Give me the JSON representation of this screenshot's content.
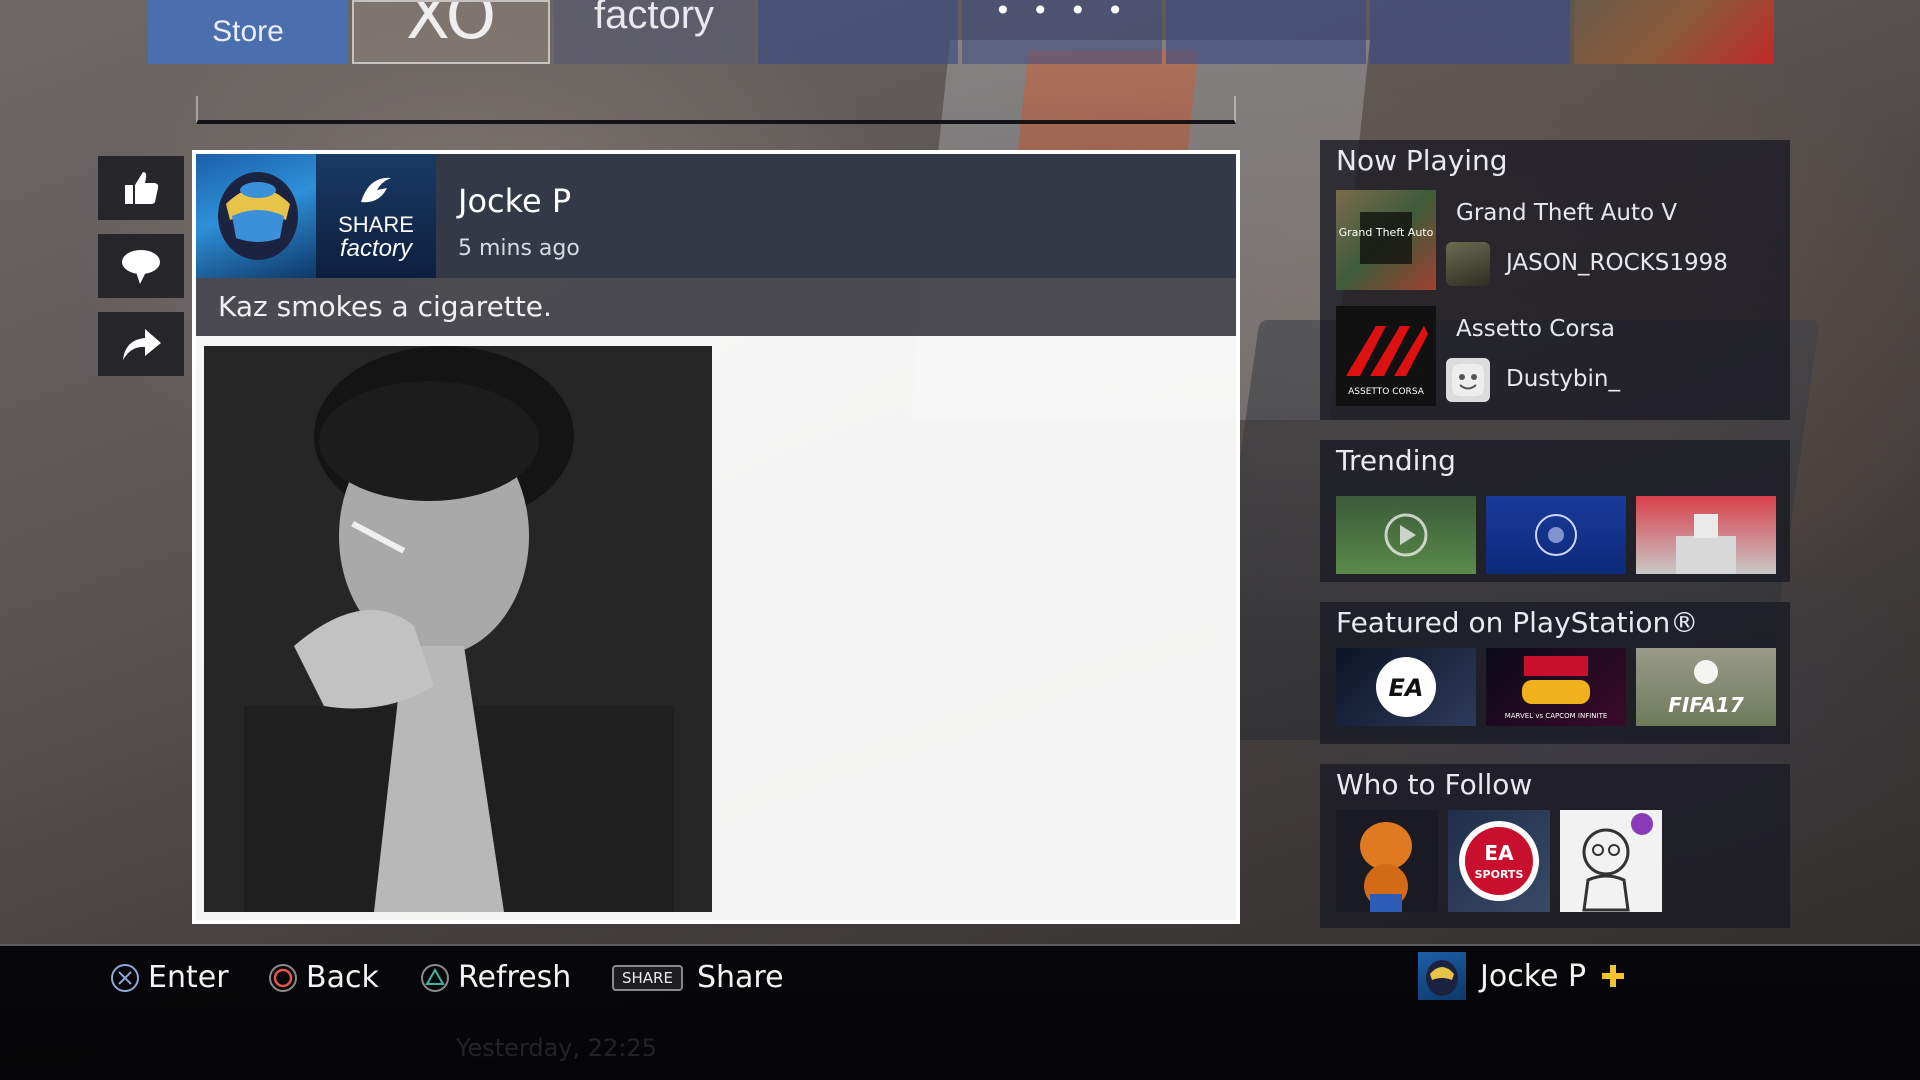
{
  "top_tiles": {
    "store_label": "Store",
    "xo_glyph": "XO",
    "factory_label": "factory",
    "dots_glyph": "• • • •"
  },
  "post": {
    "user_name": "Jocke P",
    "time_ago": "5 mins ago",
    "caption": "Kaz smokes a cigarette.",
    "app_icon_line1": "SHARE",
    "app_icon_line2": "factory"
  },
  "now_playing": {
    "title": "Now Playing",
    "entries": [
      {
        "game": "Grand Theft Auto V",
        "player": "JASON_ROCKS1998",
        "cover_text": "Grand Theft Auto"
      },
      {
        "game": "Assetto Corsa",
        "player": "Dustybin_",
        "cover_text": "ASSETTO CORSA"
      }
    ]
  },
  "trending": {
    "title": "Trending"
  },
  "featured": {
    "title": "Featured on PlayStation®",
    "tiles": [
      {
        "text": "EA"
      },
      {
        "text": "MARVEL vs CAPCOM INFINITE"
      },
      {
        "text": "FIFA17"
      }
    ]
  },
  "who_to_follow": {
    "title": "Who to Follow",
    "badge_line1": "EA",
    "badge_line2": "SPORTS"
  },
  "bottom_bar": {
    "enter": "Enter",
    "back": "Back",
    "refresh": "Refresh",
    "share_key": "SHARE",
    "share": "Share",
    "user_name": "Jocke P",
    "faded_date": "Yesterday, 22:25"
  },
  "colors": {
    "store_blue": "#4b6fae",
    "cross": "#8fa6d8",
    "circle": "#e5564a",
    "triangle": "#3fb3a0",
    "plus_gold": "#f2c230"
  }
}
